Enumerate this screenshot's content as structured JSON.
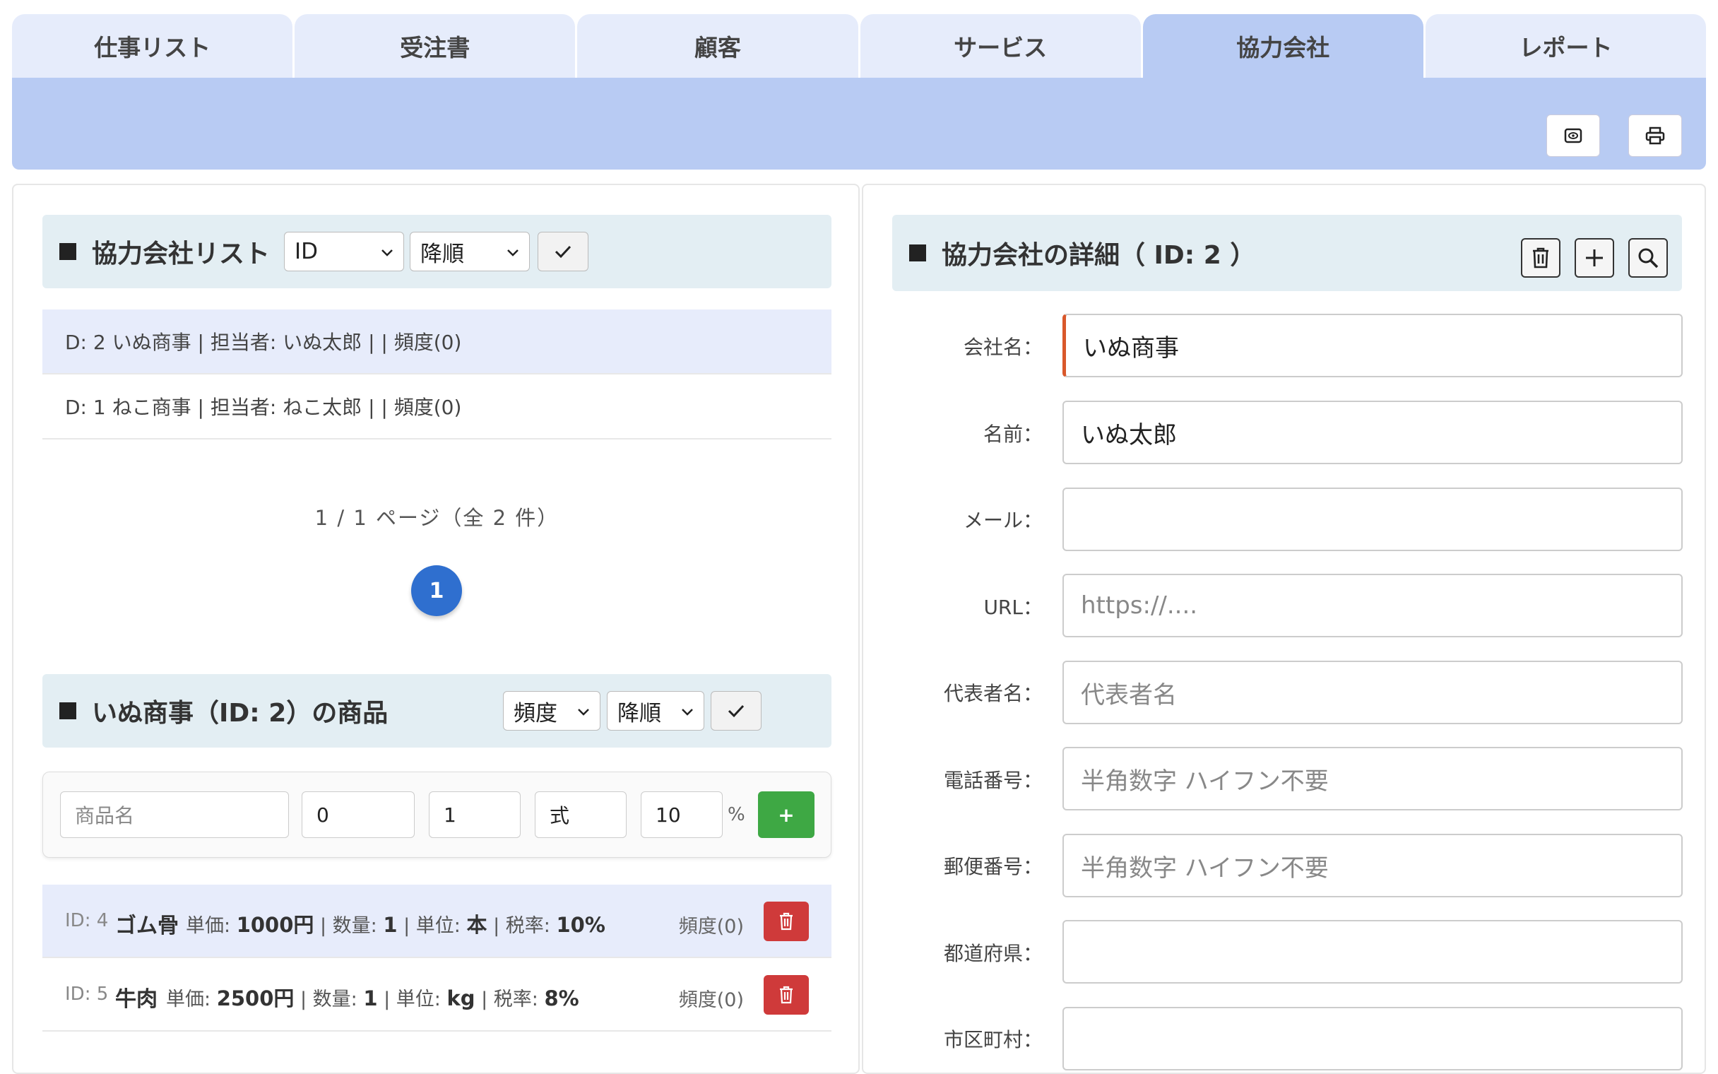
{
  "tabs": [
    "仕事リスト",
    "受注書",
    "顧客",
    "サービス",
    "協力会社",
    "レポート"
  ],
  "active_tab": "協力会社",
  "list_section": {
    "title": "協力会社リスト",
    "sort_field": "ID",
    "sort_order": "降順",
    "items": [
      "D: 2 いぬ商事 | 担当者: いぬ太郎 | | 頻度(0)",
      "D: 1 ねこ商事 | 担当者: ねこ太郎 | | 頻度(0)"
    ],
    "page_info": "1 / 1 ページ（全 2 件）",
    "current_page": "1"
  },
  "products_section": {
    "title": "いぬ商事（ID: 2）の商品",
    "sort_field": "頻度",
    "sort_order": "降順",
    "form": {
      "name_placeholder": "商品名",
      "price": "0",
      "quantity": "1",
      "unit": "式",
      "tax": "10",
      "percent": "%",
      "add_label": "+"
    },
    "items": [
      {
        "id": "ID: 4",
        "name": "ゴム骨",
        "price_label": "単価: ",
        "price": "1000円",
        "qty_label": " | 数量: ",
        "qty": "1",
        "unit_label": " | 単位: ",
        "unit": "本",
        "tax_label": " | 税率: ",
        "tax": "10%",
        "freq": "頻度(0)"
      },
      {
        "id": "ID: 5",
        "name": "牛肉",
        "price_label": "単価: ",
        "price": "2500円",
        "qty_label": " | 数量: ",
        "qty": "1",
        "unit_label": " | 単位: ",
        "unit": "kg",
        "tax_label": " | 税率: ",
        "tax": "8%",
        "freq": "頻度(0)"
      }
    ]
  },
  "detail_section": {
    "title": "協力会社の詳細（ ID: 2 ）",
    "fields": [
      {
        "label": "会社名：",
        "value": "いぬ商事",
        "placeholder": ""
      },
      {
        "label": "名前：",
        "value": "いぬ太郎",
        "placeholder": ""
      },
      {
        "label": "メール：",
        "value": "",
        "placeholder": ""
      },
      {
        "label": "URL：",
        "value": "",
        "placeholder": "https://...."
      },
      {
        "label": "代表者名：",
        "value": "",
        "placeholder": "代表者名"
      },
      {
        "label": "電話番号：",
        "value": "",
        "placeholder": "半角数字 ハイフン不要"
      },
      {
        "label": "郵便番号：",
        "value": "",
        "placeholder": "半角数字 ハイフン不要"
      },
      {
        "label": "都道府県：",
        "value": "",
        "placeholder": ""
      },
      {
        "label": "市区町村：",
        "value": "",
        "placeholder": ""
      }
    ]
  }
}
